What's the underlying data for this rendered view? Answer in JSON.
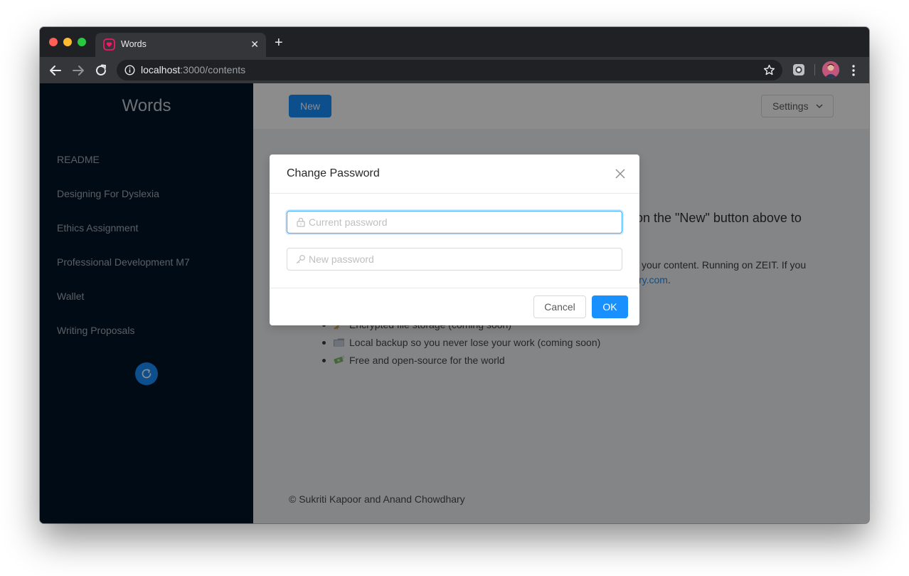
{
  "browser": {
    "tab": {
      "title": "Words",
      "favicon": "heart-favicon-icon"
    },
    "url": {
      "host": "localhost",
      "rest": ":3000/contents"
    }
  },
  "sidebar": {
    "brand": "Words",
    "items": [
      {
        "label": "README"
      },
      {
        "label": "Designing For Dyslexia"
      },
      {
        "label": "Ethics Assignment"
      },
      {
        "label": "Professional Development M7"
      },
      {
        "label": "Wallet"
      },
      {
        "label": "Writing Proposals"
      }
    ]
  },
  "header": {
    "new_label": "New",
    "settings_label": "Settings"
  },
  "content": {
    "intro_visible": "k on the \"New\" button above to",
    "para_line1_visible": "your content. Running on ZEIT. If you",
    "para_link_visible": "ry.com",
    "para_link_suffix": ".",
    "features": [
      {
        "icon": "key-icon",
        "text": "Encrypted file storage (coming soon)"
      },
      {
        "icon": "folder-icon",
        "text": "Local backup so you never lose your work (coming soon)"
      },
      {
        "icon": "money-icon",
        "text": "Free and open-source for the world"
      }
    ],
    "footer": "© Sukriti Kapoor and Anand Chowdhary"
  },
  "modal": {
    "title": "Change Password",
    "current_placeholder": "Current password",
    "new_placeholder": "New password",
    "cancel_label": "Cancel",
    "ok_label": "OK"
  },
  "colors": {
    "primary": "#1890ff",
    "sidebar_bg": "#001529",
    "chrome_dark": "#202124"
  }
}
